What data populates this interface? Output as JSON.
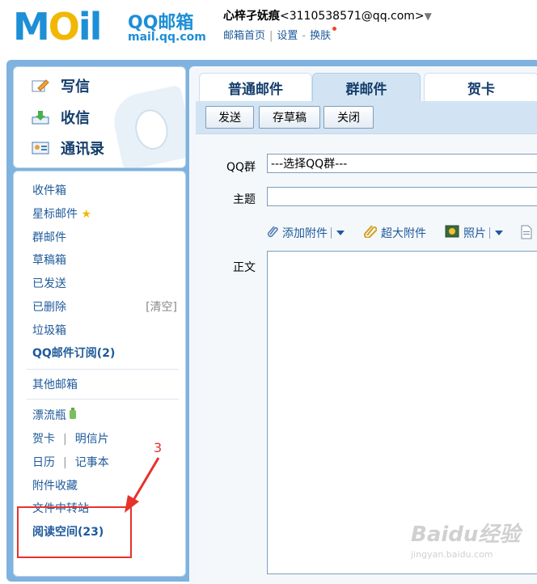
{
  "header": {
    "logo_text": "MOil",
    "logo_title": "QQ邮箱",
    "logo_domain": "mail.qq.com",
    "user_name": "心梓孑妩痕",
    "user_email": "<3110538571@qq.com>",
    "nav": [
      "邮箱首页",
      "设置",
      "换肤"
    ]
  },
  "quick_actions": [
    {
      "label": "写信",
      "icon": "pencil-icon"
    },
    {
      "label": "收信",
      "icon": "inbox-download-icon"
    },
    {
      "label": "通讯录",
      "icon": "contact-card-icon"
    }
  ],
  "folders": {
    "inbox": "收件箱",
    "starred": "星标邮件",
    "group": "群邮件",
    "drafts": "草稿箱",
    "sent": "已发送",
    "deleted": "已删除",
    "clear_label": "[清空]",
    "spam": "垃圾箱",
    "subscription": "QQ邮件订阅(2)",
    "other_mail": "其他邮箱",
    "drift_bottle": "漂流瓶",
    "greeting_card": "贺卡",
    "postcard": "明信片",
    "calendar": "日历",
    "notebook": "记事本",
    "attachments": "附件收藏",
    "file_transfer": "文件中转站",
    "reading_space": "阅读空间(23)",
    "separator": "|"
  },
  "annotation": {
    "number": "3",
    "color": "#e7322a"
  },
  "compose": {
    "tabs": [
      "普通邮件",
      "群邮件",
      "贺卡"
    ],
    "active_tab": "群邮件",
    "buttons": [
      "发送",
      "存草稿",
      "关闭"
    ],
    "qq_group_label": "QQ群",
    "qq_group_value": "---选择QQ群---",
    "subject_label": "主题",
    "subject_value": "",
    "attach_label": "添加附件",
    "big_attach_label": "超大附件",
    "photo_label": "照片",
    "body_label": "正文"
  },
  "watermark": {
    "brand": "Baidu经验",
    "url": "jingyan.baidu.com"
  },
  "colors": {
    "accent": "#1d8fd6",
    "link": "#1e5a9a",
    "frame": "#7fb2df",
    "annotation": "#e7322a"
  }
}
